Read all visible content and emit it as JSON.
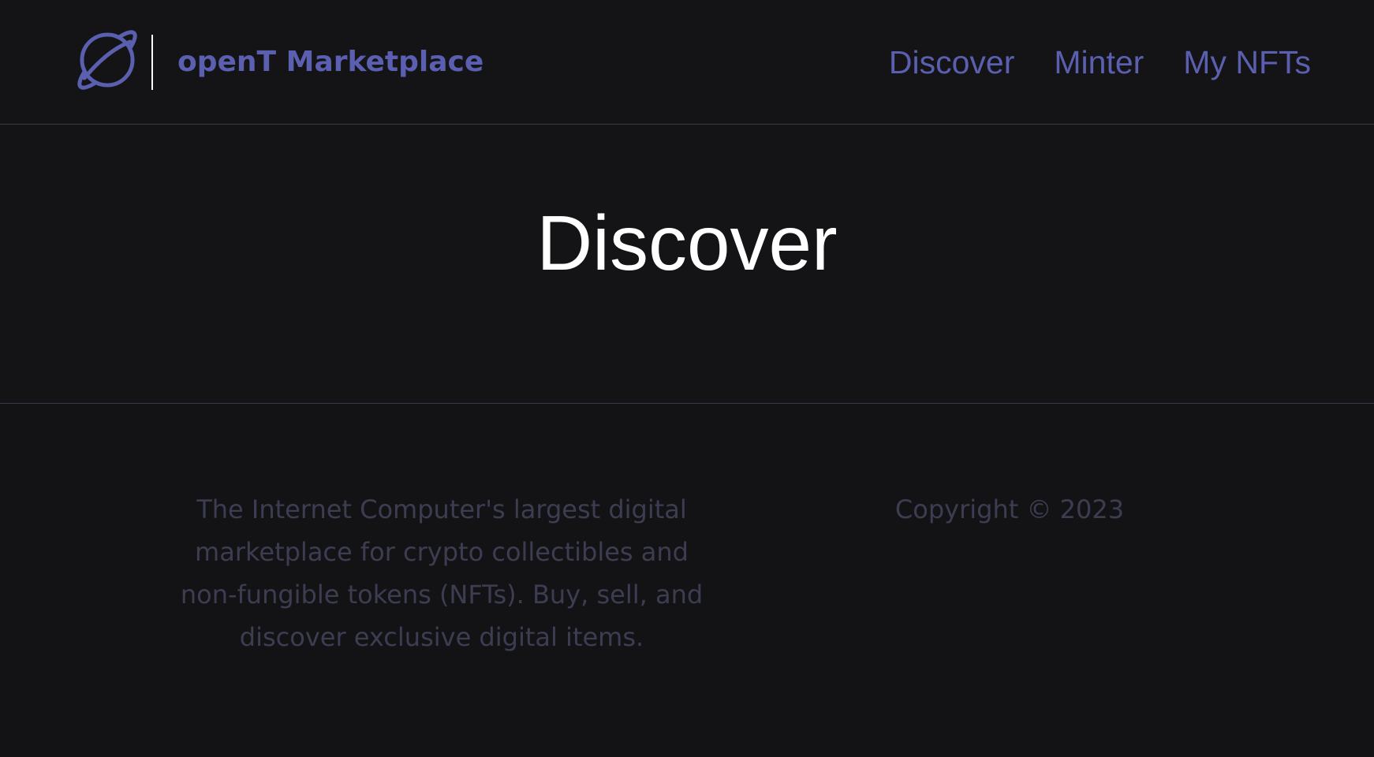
{
  "header": {
    "brand": "openT Marketplace",
    "logo_icon": "planet-icon",
    "nav": [
      {
        "label": "Discover"
      },
      {
        "label": "Minter"
      },
      {
        "label": "My NFTs"
      }
    ]
  },
  "main": {
    "title": "Discover"
  },
  "footer": {
    "description": "The Internet Computer's largest digital marketplace for crypto collectibles and non-fungible tokens (NFTs). Buy, sell, and discover exclusive digital items.",
    "copyright": "Copyright © 2023"
  },
  "colors": {
    "background": "#141417",
    "accent": "#5a5fb0",
    "muted_text": "#3d3d52",
    "divider": "#3a3a4a"
  }
}
